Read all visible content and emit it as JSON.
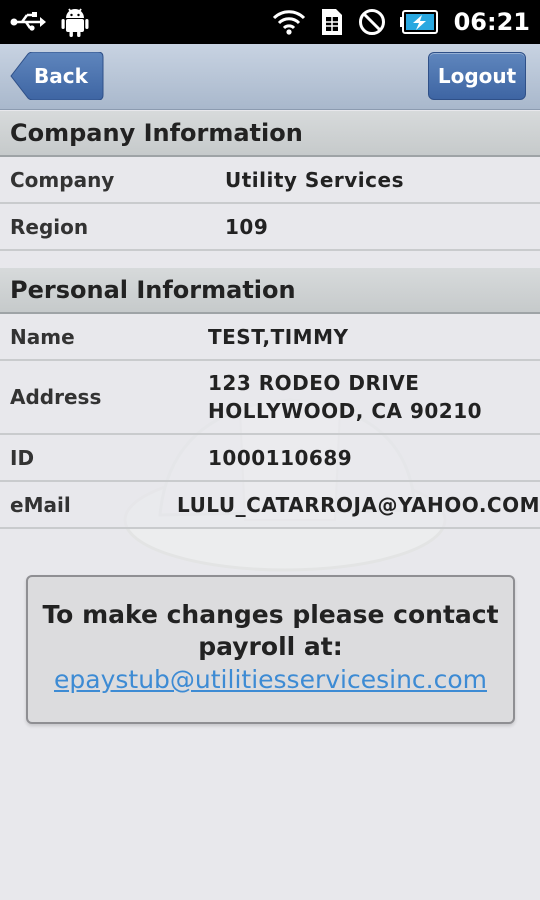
{
  "status_bar": {
    "time": "06:21",
    "icons": [
      "usb-icon",
      "android-debug-icon",
      "wifi-icon",
      "sim-icon",
      "no-signal-icon",
      "battery-charging-icon"
    ]
  },
  "header": {
    "back_label": "Back",
    "logout_label": "Logout",
    "accent_color": "#4b72ad"
  },
  "company_section": {
    "title": "Company Information",
    "rows": [
      {
        "label": "Company",
        "value": "Utility Services"
      },
      {
        "label": "Region",
        "value": "109"
      }
    ]
  },
  "personal_section": {
    "title": "Personal Information",
    "rows": [
      {
        "label": "Name",
        "value": "TEST,TIMMY"
      },
      {
        "label": "Address",
        "value_line1": "123 RODEO DRIVE",
        "value_line2": "HOLLYWOOD, CA 90210"
      },
      {
        "label": "ID",
        "value": "1000110689"
      },
      {
        "label": "eMail",
        "value": "LULU_CATARROJA@YAHOO.COM"
      }
    ]
  },
  "contact": {
    "message_line1": "To make changes please contact",
    "message_line2": "payroll at:",
    "email": "epaystub@utilitiesservicesinc.com",
    "link_color": "#3d8bd4"
  }
}
